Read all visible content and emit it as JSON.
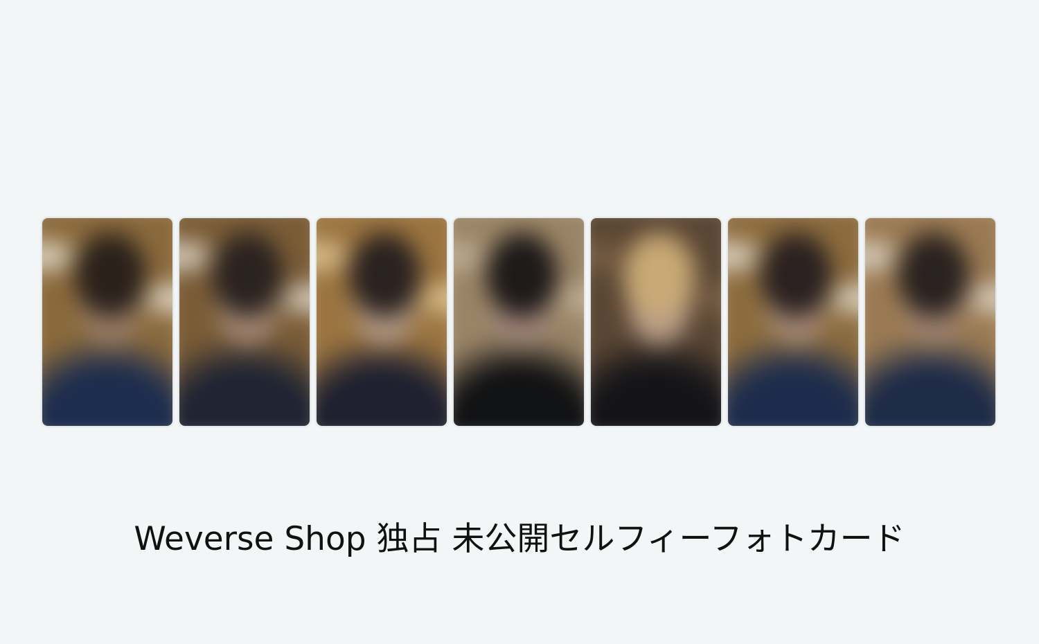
{
  "caption": "Weverse Shop 独占 未公開セルフィーフォトカード",
  "photocards": [
    {
      "palette": {
        "bg": "#8a6a3c",
        "hair": "#2a211b",
        "face": "#9a7f68",
        "outfit": "#1d2d4e",
        "light": "#efe8dc"
      }
    },
    {
      "palette": {
        "bg": "#7a5c36",
        "hair": "#2b2320",
        "face": "#a88c78",
        "outfit": "#1f2433",
        "light": "#e8e2d8"
      }
    },
    {
      "palette": {
        "bg": "#9b7440",
        "hair": "#2a2220",
        "face": "#b39a86",
        "outfit": "#1e2030",
        "light": "#e6cf9c"
      }
    },
    {
      "palette": {
        "bg": "#9a8466",
        "hair": "#1e1a19",
        "face": "#a0857a",
        "outfit": "#111214",
        "light": "#c6b49a"
      }
    },
    {
      "palette": {
        "bg": "#5a4634",
        "hair": "#c9aa76",
        "face": "#b89e88",
        "outfit": "#141418",
        "light": "#7d6448"
      }
    },
    {
      "palette": {
        "bg": "#8c6c3e",
        "hair": "#2a2120",
        "face": "#a78b78",
        "outfit": "#1d2c4c",
        "light": "#ebe4da"
      }
    },
    {
      "palette": {
        "bg": "#9a7a52",
        "hair": "#2a2220",
        "face": "#a08470",
        "outfit": "#1d2b48",
        "light": "#e4ddd2"
      }
    }
  ]
}
